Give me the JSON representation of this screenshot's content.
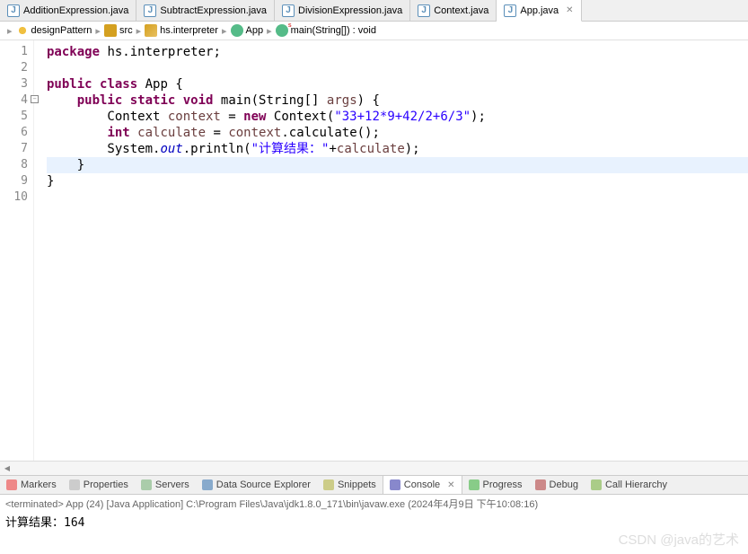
{
  "tabs": [
    {
      "label": "AdditionExpression.java"
    },
    {
      "label": "SubtractExpression.java"
    },
    {
      "label": "DivisionExpression.java"
    },
    {
      "label": "Context.java"
    },
    {
      "label": "App.java",
      "active": true
    }
  ],
  "breadcrumb": {
    "items": [
      {
        "label": "designPattern"
      },
      {
        "label": "src"
      },
      {
        "label": "hs.interpreter"
      },
      {
        "label": "App"
      },
      {
        "label": "main(String[]) : void"
      }
    ]
  },
  "gutter": [
    "1",
    "2",
    "3",
    "4",
    "5",
    "6",
    "7",
    "8",
    "9",
    "10"
  ],
  "code": {
    "l1": {
      "kw1": "package",
      "rest": " hs.interpreter;"
    },
    "l3": {
      "kw1": "public",
      "kw2": "class",
      "name": " App {"
    },
    "l4": {
      "kw1": "public",
      "kw2": "static",
      "kw3": "void",
      "name": " main(String[] ",
      "arg": "args",
      "end": ") {"
    },
    "l5": {
      "t1": "        Context ",
      "v1": "context",
      "t2": " = ",
      "kw": "new",
      "t3": " Context(",
      "str": "\"33+12*9+42/2+6/3\"",
      "t4": ");"
    },
    "l6": {
      "t1": "        ",
      "kw": "int",
      "t2": " ",
      "v1": "calculate",
      "t3": " = ",
      "v2": "context",
      "t4": ".calculate();"
    },
    "l7": {
      "t1": "        System.",
      "sf": "out",
      "t2": ".println(",
      "str": "\"计算结果：\"",
      "t3": "+",
      "v1": "calculate",
      "t4": ");"
    },
    "l8": "    }",
    "l9": "}"
  },
  "bottomTabs": [
    {
      "label": "Markers"
    },
    {
      "label": "Properties"
    },
    {
      "label": "Servers"
    },
    {
      "label": "Data Source Explorer"
    },
    {
      "label": "Snippets"
    },
    {
      "label": "Console",
      "active": true
    },
    {
      "label": "Progress"
    },
    {
      "label": "Debug"
    },
    {
      "label": "Call Hierarchy"
    }
  ],
  "console": {
    "status": "<terminated> App (24) [Java Application] C:\\Program Files\\Java\\jdk1.8.0_171\\bin\\javaw.exe (2024年4月9日 下午10:08:16)",
    "output": "计算结果：164"
  },
  "watermark": "CSDN @java的艺术",
  "closeGlyph": "✕"
}
